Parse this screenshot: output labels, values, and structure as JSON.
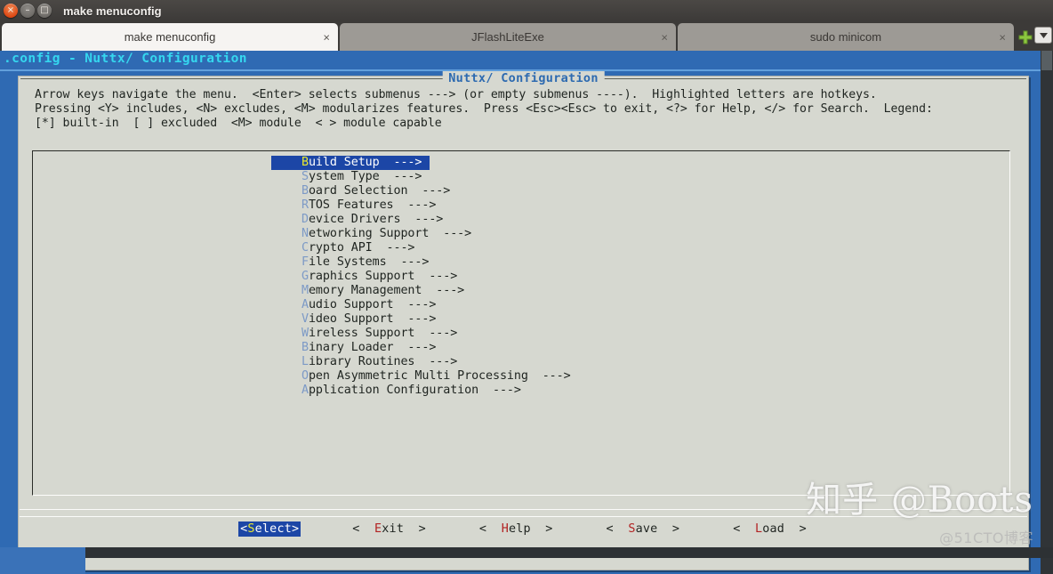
{
  "window": {
    "title": "make menuconfig",
    "controls": [
      {
        "name": "close",
        "glyph": "×"
      },
      {
        "name": "minimize",
        "glyph": "–"
      },
      {
        "name": "maximize",
        "glyph": "□"
      }
    ]
  },
  "tabs": [
    {
      "label": "make menuconfig",
      "active": true,
      "close": "×"
    },
    {
      "label": "JFlashLiteExe",
      "active": false,
      "close": "×"
    },
    {
      "label": "sudo minicom",
      "active": false,
      "close": "×"
    }
  ],
  "tab_tools": {
    "new_tab": "new-tab-icon",
    "dropdown": "▾"
  },
  "terminal": {
    "title": ".config - Nuttx/ Configuration"
  },
  "dialog": {
    "title": "Nuttx/ Configuration",
    "help_line1": "Arrow keys navigate the menu.  <Enter> selects submenus ---> (or empty submenus ----).  Highlighted letters are hotkeys.",
    "help_line2": "Pressing <Y> includes, <N> excludes, <M> modularizes features.  Press <Esc><Esc> to exit, <?> for Help, </> for Search.  Legend:",
    "help_line3": "[*] built-in  [ ] excluded  <M> module  < > module capable"
  },
  "menu": {
    "items": [
      {
        "hotkey": "B",
        "rest": "uild Setup",
        "arrow": "  --->",
        "selected": true
      },
      {
        "hotkey": "S",
        "rest": "ystem Type",
        "arrow": "  --->",
        "selected": false
      },
      {
        "hotkey": "B",
        "rest": "oard Selection",
        "arrow": "  --->",
        "selected": false
      },
      {
        "hotkey": "R",
        "rest": "TOS Features",
        "arrow": "  --->",
        "selected": false
      },
      {
        "hotkey": "D",
        "rest": "evice Drivers",
        "arrow": "  --->",
        "selected": false
      },
      {
        "hotkey": "N",
        "rest": "etworking Support",
        "arrow": "  --->",
        "selected": false
      },
      {
        "hotkey": "C",
        "rest": "rypto API",
        "arrow": "  --->",
        "selected": false
      },
      {
        "hotkey": "F",
        "rest": "ile Systems",
        "arrow": "  --->",
        "selected": false
      },
      {
        "hotkey": "G",
        "rest": "raphics Support",
        "arrow": "  --->",
        "selected": false
      },
      {
        "hotkey": "M",
        "rest": "emory Management",
        "arrow": "  --->",
        "selected": false
      },
      {
        "hotkey": "A",
        "rest": "udio Support",
        "arrow": "  --->",
        "selected": false
      },
      {
        "hotkey": "V",
        "rest": "ideo Support",
        "arrow": "  --->",
        "selected": false
      },
      {
        "hotkey": "W",
        "rest": "ireless Support",
        "arrow": "  --->",
        "selected": false
      },
      {
        "hotkey": "B",
        "rest": "inary Loader",
        "arrow": "  --->",
        "selected": false
      },
      {
        "hotkey": "L",
        "rest": "ibrary Routines",
        "arrow": "  --->",
        "selected": false
      },
      {
        "hotkey": "O",
        "rest": "pen Asymmetric Multi Processing",
        "arrow": "  --->",
        "selected": false
      },
      {
        "hotkey": "A",
        "rest": "pplication Configuration",
        "arrow": "  --->",
        "selected": false
      }
    ]
  },
  "buttons": [
    {
      "pre": "<",
      "hotkey": "S",
      "rest": "elect",
      "post": ">",
      "primary": true
    },
    {
      "pre": "<  ",
      "hotkey": "E",
      "rest": "xit",
      "post": "  >",
      "primary": false
    },
    {
      "pre": "<  ",
      "hotkey": "H",
      "rest": "elp",
      "post": "  >",
      "primary": false
    },
    {
      "pre": "<  ",
      "hotkey": "S",
      "rest": "ave",
      "post": "  >",
      "primary": false
    },
    {
      "pre": "<  ",
      "hotkey": "L",
      "rest": "oad",
      "post": "  >",
      "primary": false
    }
  ],
  "watermark": {
    "main": "知乎 @Boots",
    "sub": "@51CTO博客"
  },
  "colors": {
    "terminal_bg": "#2f6ab3",
    "dialog_bg": "#d6d8d0",
    "title_cyan": "#35d7ef",
    "select_blue": "#1c46a6",
    "hotkey_blue": "#7d9ac6",
    "hotkey_yellow": "#e9e82e",
    "button_hotkey_red": "#b22222"
  }
}
